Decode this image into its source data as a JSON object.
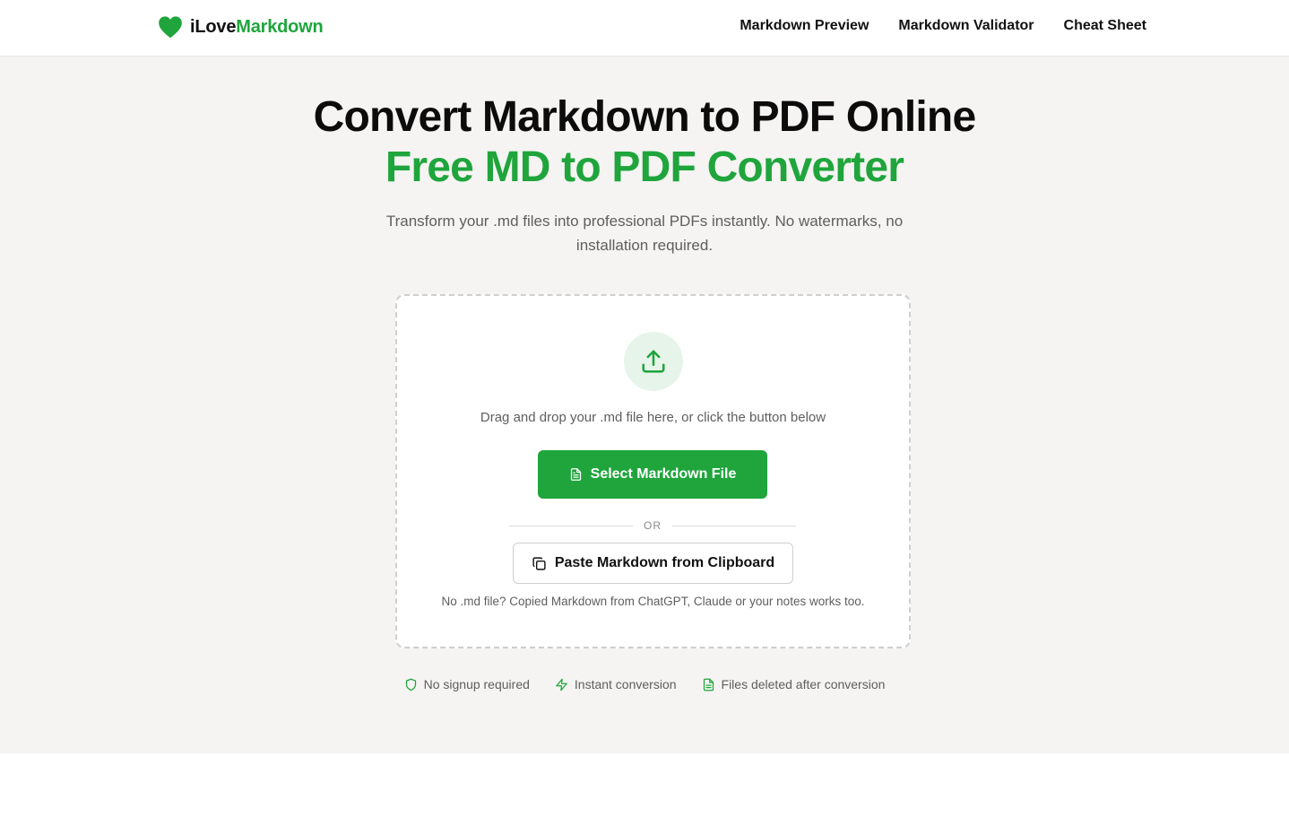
{
  "brand": {
    "name_part1": "iLove",
    "name_part2": "Markdown",
    "icon": "heart-icon",
    "accent_color": "#1fa53c"
  },
  "nav": {
    "items": [
      {
        "label": "Markdown Preview"
      },
      {
        "label": "Markdown Validator"
      },
      {
        "label": "Cheat Sheet"
      }
    ]
  },
  "hero": {
    "title_line1": "Convert Markdown to PDF Online",
    "title_line2": "Free MD to PDF Converter",
    "subtitle": "Transform your .md files into professional PDFs instantly. No watermarks, no installation required."
  },
  "dropzone": {
    "icon": "upload-icon",
    "instruction": "Drag and drop your .md file here, or click the button below",
    "select_label": "Select Markdown File",
    "select_icon": "file-icon",
    "divider_label": "OR",
    "paste_label": "Paste Markdown from Clipboard",
    "paste_icon": "copy-icon",
    "hint": "No .md file? Copied Markdown from ChatGPT, Claude or your notes works too."
  },
  "features": [
    {
      "icon": "shield-icon",
      "label": "No signup required"
    },
    {
      "icon": "lightning-icon",
      "label": "Instant conversion"
    },
    {
      "icon": "document-icon",
      "label": "Files deleted after conversion"
    }
  ]
}
